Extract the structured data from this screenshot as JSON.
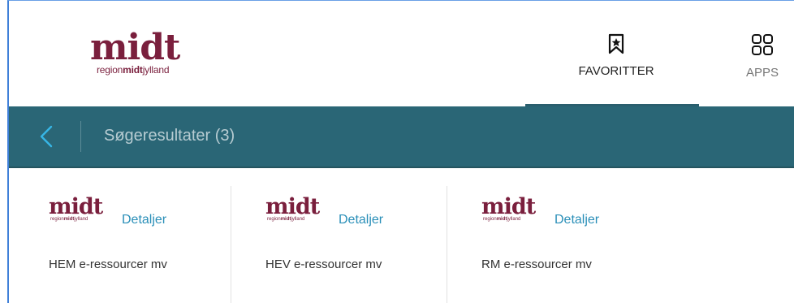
{
  "header": {
    "logo_word": "midt",
    "logo_sub_prefix": "region",
    "logo_sub_bold": "midt",
    "logo_sub_suffix": "jylland",
    "favorites_label": "FAVORITTER",
    "apps_label": "APPS",
    "favorites_icon": "bookmark-star-icon",
    "apps_icon": "grid-apps-icon"
  },
  "bar": {
    "back_icon": "chevron-left-icon",
    "title": "Søgeresultater (3)"
  },
  "results": [
    {
      "logo_word": "midt",
      "logo_sub_prefix": "region",
      "logo_sub_bold": "midt",
      "logo_sub_suffix": "jylland",
      "link": "Detaljer",
      "name": "HEM e-ressourcer mv"
    },
    {
      "logo_word": "midt",
      "logo_sub_prefix": "region",
      "logo_sub_bold": "midt",
      "logo_sub_suffix": "jylland",
      "link": "Detaljer",
      "name": "HEV e-ressourcer mv"
    },
    {
      "logo_word": "midt",
      "logo_sub_prefix": "region",
      "logo_sub_bold": "midt",
      "logo_sub_suffix": "jylland",
      "link": "Detaljer",
      "name": "RM e-ressourcer mv"
    }
  ],
  "colors": {
    "brand": "#7a1f3d",
    "bar": "#2a6676",
    "link": "#2a8fb8",
    "back_icon": "#36b6e6"
  }
}
